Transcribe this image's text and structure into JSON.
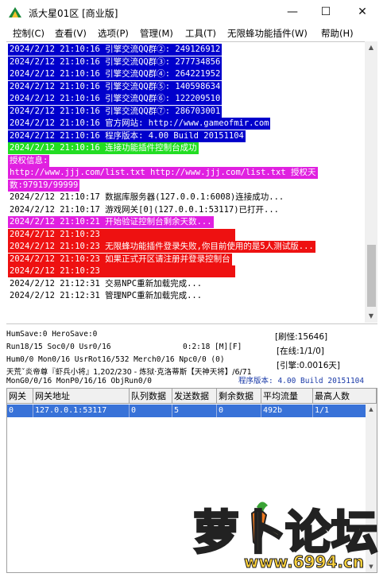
{
  "window": {
    "title": "派大星01区 [商业版]",
    "minimize": "—",
    "maximize": "☐",
    "close": "✕"
  },
  "menu": [
    {
      "label": "控制(C)"
    },
    {
      "label": "查看(V)"
    },
    {
      "label": "选项(P)"
    },
    {
      "label": "管理(M)"
    },
    {
      "label": "工具(T)"
    },
    {
      "label": "无限蜂功能插件(W)"
    },
    {
      "label": "帮助(H)"
    }
  ],
  "colors": {
    "blue": "#0000cc",
    "green": "#22dd22",
    "magenta": "#e020e0",
    "red": "#ee1111",
    "selection": "#3872d8"
  },
  "log": [
    {
      "text": "2024/2/12 21:10:16 引擎交流QQ群②: 249126912",
      "bg": "#0000cc",
      "fg": "#ffffff"
    },
    {
      "text": "2024/2/12 21:10:16 引擎交流QQ群③: 277734856",
      "bg": "#0000cc",
      "fg": "#ffffff"
    },
    {
      "text": "2024/2/12 21:10:16 引擎交流QQ群④: 264221952",
      "bg": "#0000cc",
      "fg": "#ffffff"
    },
    {
      "text": "2024/2/12 21:10:16 引擎交流QQ群⑤: 140598634",
      "bg": "#0000cc",
      "fg": "#ffffff"
    },
    {
      "text": "2024/2/12 21:10:16 引擎交流QQ群⑥: 122209510",
      "bg": "#0000cc",
      "fg": "#ffffff"
    },
    {
      "text": "2024/2/12 21:10:16 引擎交流QQ群⑦: 286703001",
      "bg": "#0000cc",
      "fg": "#ffffff"
    },
    {
      "text": "2024/2/12 21:10:16 官方网站: http://www.gameofmir.com",
      "bg": "#0000cc",
      "fg": "#ffffff"
    },
    {
      "text": "2024/2/12 21:10:16 程序版本: 4.00 Build 20151104",
      "bg": "#0000cc",
      "fg": "#ffffff"
    },
    {
      "text": "2024/2/12 21:10:16 连接功能插件控制台成功",
      "bg": "#22dd22",
      "fg": "#ffffff"
    },
    {
      "text": "授权信息:",
      "bg": "#e020e0",
      "fg": "#ffffff"
    },
    {
      "text": "http://www.jjj.com/list.txt http://www.jjj.com/list.txt 授权天",
      "bg": "#e020e0",
      "fg": "#ffffff"
    },
    {
      "text": "数:97919/99999",
      "bg": "#e020e0",
      "fg": "#ffffff"
    },
    {
      "text": "2024/2/12 21:10:17 数据库服务器(127.0.0.1:6008)连接成功...",
      "bg": "#ffffff",
      "fg": "#000000"
    },
    {
      "text": "2024/2/12 21:10:17 游戏网关[0](127.0.0.1:53117)已打开...",
      "bg": "#ffffff",
      "fg": "#000000"
    },
    {
      "text": "2024/2/12 21:10:21 开始验证控制台剩余天数...",
      "bg": "#e020e0",
      "fg": "#ffffff"
    },
    {
      "text": "2024/2/12 21:10:23 ",
      "bg": "#ee1111",
      "fg": "#ffffff"
    },
    {
      "text": "2024/2/12 21:10:23 无限蜂功能插件登录失败,你目前使用的是5人测试版...",
      "bg": "#ee1111",
      "fg": "#ffffff"
    },
    {
      "text": "2024/2/12 21:10:23 如果正式开区请注册并登录控制台",
      "bg": "#ee1111",
      "fg": "#ffffff"
    },
    {
      "text": "2024/2/12 21:10:23 ",
      "bg": "#ee1111",
      "fg": "#ffffff"
    },
    {
      "text": "2024/2/12 21:12:31 交易NPC重新加载完成...",
      "bg": "#ffffff",
      "fg": "#000000"
    },
    {
      "text": "2024/2/12 21:12:31 管理NPC重新加载完成...",
      "bg": "#ffffff",
      "fg": "#000000"
    }
  ],
  "stats": {
    "humsave": "HumSave:0 HeroSave:0",
    "run": "Run18/15 Soc0/0 Usr0/16",
    "uptime": "0:2:18 [M][F]",
    "hum": "Hum0/0 Mon0/16 UsrRot16/532 Merch0/16 Npc0/0 (0)",
    "map": "天荒ˇ炎帝尊『虾兵小将』1,202/230 - 炼狱·克洛蒂斯【天神天将】/6/71",
    "mon": "MonG0/0/16 MonP0/16/16 ObjRun0/0",
    "refresh": "[刷怪:15646]",
    "online": "[在线:1/1/0]",
    "ratio": "[引擎:0.0016天]",
    "version": "程序版本: 4.00 Build 20151104"
  },
  "grid": {
    "headers": [
      "网关",
      "网关地址",
      "队列数据",
      "发送数据",
      "剩余数据",
      "平均流量",
      "最高人数"
    ],
    "rows": [
      [
        "0",
        "127.0.0.1:53117",
        "0",
        "5",
        "0",
        "492b",
        "1/1"
      ]
    ]
  },
  "watermark": {
    "text": "萝卜论坛",
    "url": "www.6994.cn"
  }
}
